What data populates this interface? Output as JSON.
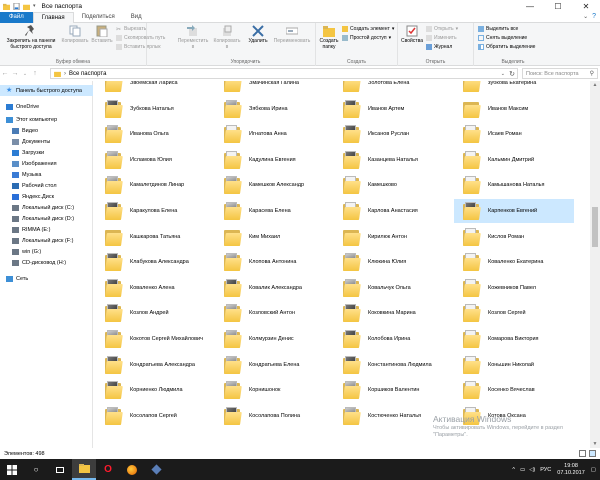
{
  "window": {
    "title": "Все паспорта",
    "buttons": [
      "—",
      "☐",
      "✕"
    ]
  },
  "tabs": [
    {
      "label": "Файл"
    },
    {
      "label": "Главная"
    },
    {
      "label": "Поделиться"
    },
    {
      "label": "Вид"
    }
  ],
  "ribbon": {
    "clipboard": {
      "pin_label": "Закрепить на панели быстрого доступа",
      "copy_label": "Копировать",
      "paste_label": "Вставить",
      "cut_label": "Вырезать",
      "copy_path_label": "Скопировать путь",
      "paste_shortcut_label": "Вставить ярлык",
      "group_label": "Буфер обмена"
    },
    "organize": {
      "move_label": "Переместить в",
      "copy_to_label": "Копировать в",
      "delete_label": "Удалить",
      "rename_label": "Переименовать",
      "group_label": "Упорядочить"
    },
    "new": {
      "new_folder_label": "Создать папку",
      "new_item_label": "Создать элемент",
      "easy_access_label": "Простой доступ",
      "group_label": "Создать"
    },
    "open": {
      "properties_label": "Свойства",
      "open_label": "Открыть",
      "edit_label": "Изменить",
      "history_label": "Журнал",
      "group_label": "Открыть"
    },
    "select": {
      "select_all_label": "Выделить все",
      "select_none_label": "Снять выделение",
      "invert_label": "Обратить выделение",
      "group_label": "Выделить"
    }
  },
  "address": {
    "path": "Все паспорта",
    "search_placeholder": "Поиск: Все паспорта"
  },
  "nav": {
    "items": [
      {
        "label": "Панель быстрого доступа",
        "icon": "star-icon",
        "color": "#3a8ee6"
      },
      {
        "label": "OneDrive",
        "icon": "cloud-icon",
        "color": "#2b7cd3"
      },
      {
        "label": "Этот компьютер",
        "icon": "computer-icon",
        "color": "#3d8fd6"
      },
      {
        "label": "Видео",
        "icon": "video-icon",
        "color": "#4a7cb6"
      },
      {
        "label": "Документы",
        "icon": "documents-icon",
        "color": "#7a8ea8"
      },
      {
        "label": "Загрузки",
        "icon": "downloads-icon",
        "color": "#2b7cd3"
      },
      {
        "label": "Изображения",
        "icon": "pictures-icon",
        "color": "#5a8fc8"
      },
      {
        "label": "Музыка",
        "icon": "music-icon",
        "color": "#3a7bd5"
      },
      {
        "label": "Рабочий стол",
        "icon": "desktop-icon",
        "color": "#2b6cb3"
      },
      {
        "label": "Яндекс.Диск",
        "icon": "yandex-disk-icon",
        "color": "#2a6fd8"
      },
      {
        "label": "Локальный диск (C:)",
        "icon": "drive-icon",
        "color": "#6b7785"
      },
      {
        "label": "Локальный диск (D:)",
        "icon": "drive-icon",
        "color": "#6b7785"
      },
      {
        "label": "RIMMA (E:)",
        "icon": "drive-icon",
        "color": "#6b7785"
      },
      {
        "label": "Локальный диск (F:)",
        "icon": "drive-icon",
        "color": "#6b7785"
      },
      {
        "label": "win (G:)",
        "icon": "drive-icon",
        "color": "#6b7785"
      },
      {
        "label": "CD-дисковод (H:)",
        "icon": "cd-drive-icon",
        "color": "#6b7785"
      },
      {
        "label": "Сеть",
        "icon": "network-icon",
        "color": "#3d8fd6"
      }
    ]
  },
  "folders": [
    {
      "name": "Звоемская Лариса",
      "paper": "light"
    },
    {
      "name": "Змачинская Галина",
      "paper": "dark"
    },
    {
      "name": "Золотова Елена",
      "paper": "dark"
    },
    {
      "name": "зубкова Екатерина",
      "paper": "dark"
    },
    {
      "name": "Зубкова Наталья",
      "paper": "dark"
    },
    {
      "name": "Зябкова Ирина",
      "paper": "mid"
    },
    {
      "name": "Иванов Артем",
      "paper": "dark"
    },
    {
      "name": "Иванов Максим",
      "paper": "none"
    },
    {
      "name": "Иванова Ольга",
      "paper": "mid"
    },
    {
      "name": "Игнатова Анна",
      "paper": "light"
    },
    {
      "name": "Иксанов Руслан",
      "paper": "dark"
    },
    {
      "name": "Исаев Роман",
      "paper": "light"
    },
    {
      "name": "Исламова Юлия",
      "paper": "mid"
    },
    {
      "name": "Кадулина Евгения",
      "paper": "light"
    },
    {
      "name": "Казанцева Наталья",
      "paper": "dark"
    },
    {
      "name": "Кальмин Дмитрий",
      "paper": "light"
    },
    {
      "name": "Камалетдинов Линар",
      "paper": "mid"
    },
    {
      "name": "Камешков Александр",
      "paper": "mid"
    },
    {
      "name": "Камешково",
      "paper": "light"
    },
    {
      "name": "Камышанова Наталья",
      "paper": "light"
    },
    {
      "name": "Каракулова Елена",
      "paper": "dark"
    },
    {
      "name": "Карасева Елена",
      "paper": "mid"
    },
    {
      "name": "Карлова Анастасия",
      "paper": "light"
    },
    {
      "name": "Карпенков Евгений",
      "paper": "dark"
    },
    {
      "name": "Кашкарова Татьяна",
      "paper": "none"
    },
    {
      "name": "Ким Михаил",
      "paper": "none"
    },
    {
      "name": "Кирилюк Антон",
      "paper": "none"
    },
    {
      "name": "Кислов Роман",
      "paper": "light"
    },
    {
      "name": "Клабукова Александра",
      "paper": "dark"
    },
    {
      "name": "Клопова Антонина",
      "paper": "mid"
    },
    {
      "name": "Клюкина Юлия",
      "paper": "mid"
    },
    {
      "name": "Коваленко Екатерина",
      "paper": "light"
    },
    {
      "name": "Коваленко Алена",
      "paper": "dark"
    },
    {
      "name": "Ковалик Александра",
      "paper": "dark"
    },
    {
      "name": "Ковальчук Ольга",
      "paper": "mid"
    },
    {
      "name": "Кожевников Павел",
      "paper": "light"
    },
    {
      "name": "Козлов Андрей",
      "paper": "dark"
    },
    {
      "name": "Козловский Антон",
      "paper": "mid"
    },
    {
      "name": "Коковкина Марина",
      "paper": "dark"
    },
    {
      "name": "Козлов Сергей",
      "paper": "light"
    },
    {
      "name": "Кокотов Сергей Михайлович",
      "paper": "mid"
    },
    {
      "name": "Колмурзин Денис",
      "paper": "mid"
    },
    {
      "name": "Колобова Ирина",
      "paper": "dark"
    },
    {
      "name": "Комарова Виктория",
      "paper": "light"
    },
    {
      "name": "Кондратьева Александра",
      "paper": "dark"
    },
    {
      "name": "Кондратьева Елена",
      "paper": "mid"
    },
    {
      "name": "Константинова Людмила",
      "paper": "dark"
    },
    {
      "name": "Коньшин Николай",
      "paper": "light"
    },
    {
      "name": "Корниенко Людмила",
      "paper": "dark"
    },
    {
      "name": "Корнишонок",
      "paper": "mid"
    },
    {
      "name": "Коршиков Валентин",
      "paper": "mid"
    },
    {
      "name": "Косенко Вячеслав",
      "paper": "light"
    },
    {
      "name": "Косолапов Сергей",
      "paper": "mid"
    },
    {
      "name": "Косолапова Полина",
      "paper": "dark"
    },
    {
      "name": "Костюченко Наталья",
      "paper": "mid"
    },
    {
      "name": "Котова Оксана",
      "paper": "light"
    }
  ],
  "selected_folder": "Карпенков Евгений",
  "status": {
    "count_label": "Элементов: 498"
  },
  "watermark": {
    "title": "Активация Windows",
    "text": "Чтобы активировать Windows, перейдите в раздел \"Параметры\"."
  },
  "taskbar": {
    "lang": "РУС",
    "time": "19:08",
    "date": "07.10.2017"
  },
  "colors": {
    "accent": "#1979ca",
    "selection": "#cce8ff",
    "taskbar": "#1b1b1b"
  }
}
